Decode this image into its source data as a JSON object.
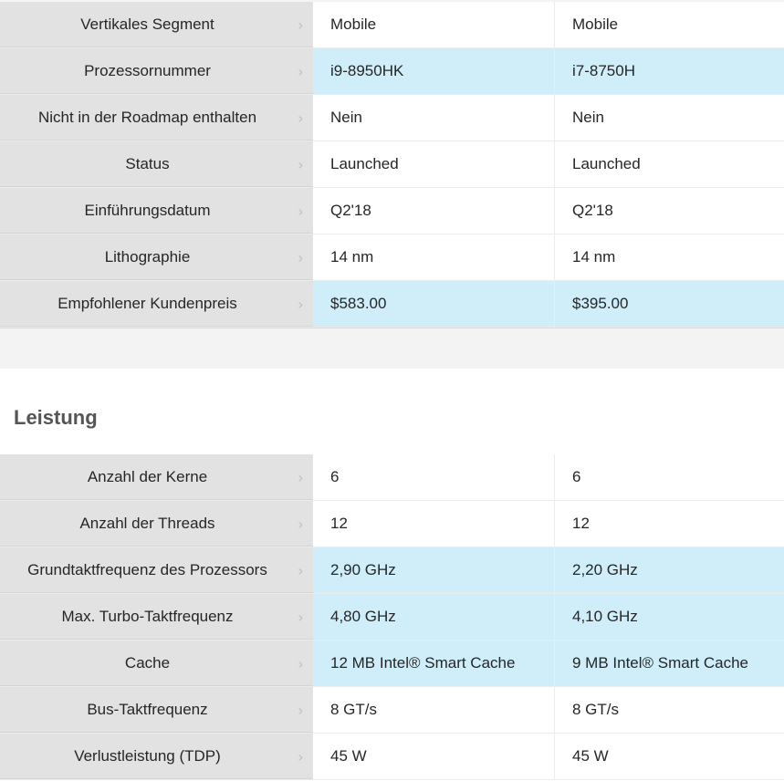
{
  "table_top": {
    "rows": [
      {
        "label": "Vertikales Segment",
        "v1": "Mobile",
        "v2": "Mobile"
      },
      {
        "label": "Prozessornummer",
        "v1": "i9-8950HK",
        "v2": "i7-8750H"
      },
      {
        "label": "Nicht in der Roadmap enthalten",
        "v1": "Nein",
        "v2": "Nein"
      },
      {
        "label": "Status",
        "v1": "Launched",
        "v2": "Launched"
      },
      {
        "label": "Einführungsdatum",
        "v1": "Q2'18",
        "v2": "Q2'18"
      },
      {
        "label": "Lithographie",
        "v1": "14 nm",
        "v2": "14 nm"
      },
      {
        "label": "Empfohlener Kundenpreis",
        "v1": "$583.00",
        "v2": "$395.00"
      }
    ]
  },
  "section_performance": {
    "title": "Leistung",
    "rows": [
      {
        "label": "Anzahl der Kerne",
        "v1": "6",
        "v2": "6"
      },
      {
        "label": "Anzahl der Threads",
        "v1": "12",
        "v2": "12"
      },
      {
        "label": "Grundtaktfrequenz des Prozessors",
        "v1": "2,90 GHz",
        "v2": "2,20 GHz"
      },
      {
        "label": "Max. Turbo-Taktfrequenz",
        "v1": "4,80 GHz",
        "v2": "4,10 GHz"
      },
      {
        "label": "Cache",
        "v1": "12 MB Intel® Smart Cache",
        "v2": "9 MB Intel® Smart Cache"
      },
      {
        "label": "Bus-Taktfrequenz",
        "v1": "8 GT/s",
        "v2": "8 GT/s"
      },
      {
        "label": "Verlustleistung (TDP)",
        "v1": "45 W",
        "v2": "45 W"
      }
    ]
  },
  "chevron_glyph": "›",
  "colors": {
    "label_bg": "#e2e2e2",
    "highlight_bg": "#cfeefa",
    "section_title": "#555555"
  }
}
